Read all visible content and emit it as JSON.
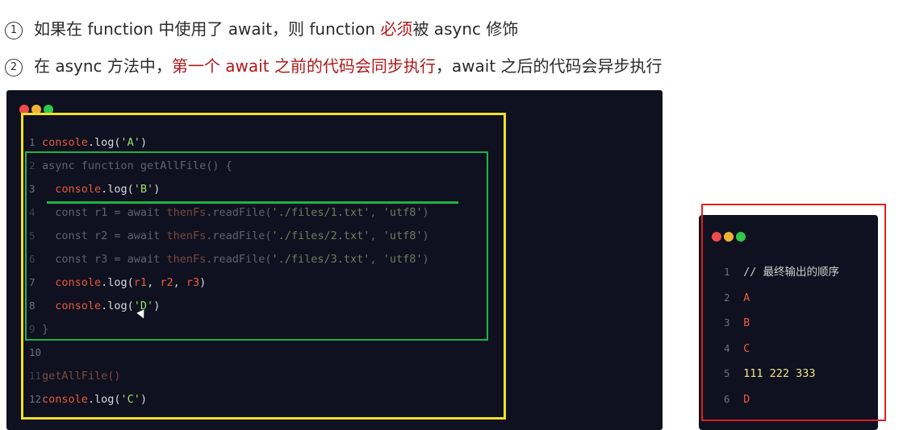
{
  "bullets": [
    {
      "marker": "1",
      "pre": "如果在 function 中使用了 await，则 function ",
      "highlight": "必须",
      "post": "被 async 修饰"
    },
    {
      "marker": "2",
      "pre": "在 async 方法中，",
      "highlight": "第一个 await 之前的代码会同步执行",
      "post": "，await 之后的代码会异步执行"
    }
  ],
  "colors": {
    "highlight_text": "#b01818",
    "editor_bg": "#0f1120",
    "yellow_box": "#f2e02a",
    "green_box": "#1fb344",
    "red_box": "#e01f1f"
  },
  "code": {
    "l1": {
      "n": "1",
      "a": "console",
      "b": ".log(",
      "c": "'A'",
      "d": ")"
    },
    "l2": {
      "n": "2",
      "a": "async function getAllFile() {"
    },
    "l3": {
      "n": "3",
      "a": "  console",
      "b": ".log(",
      "c": "'B'",
      "d": ")"
    },
    "l4": {
      "n": "4",
      "a": "  const r1 = await ",
      "b": "thenFs",
      "c": ".readFile(",
      "d": "'./files/1.txt'",
      "e": ", ",
      "f": "'utf8'",
      "g": ")"
    },
    "l5": {
      "n": "5",
      "a": "  const r2 = await ",
      "b": "thenFs",
      "c": ".readFile(",
      "d": "'./files/2.txt'",
      "e": ", ",
      "f": "'utf8'",
      "g": ")"
    },
    "l6": {
      "n": "6",
      "a": "  const r3 = await ",
      "b": "thenFs",
      "c": ".readFile(",
      "d": "'./files/3.txt'",
      "e": ", ",
      "f": "'utf8'",
      "g": ")"
    },
    "l7": {
      "n": "7",
      "a": "  console",
      "b": ".log(",
      "c": "r1",
      "d": ", ",
      "e": "r2",
      "f": ", ",
      "g": "r3",
      "h": ")"
    },
    "l8": {
      "n": "8",
      "a": "  console",
      "b": ".log(",
      "c": "'D'",
      "d": ")"
    },
    "l9": {
      "n": "9",
      "a": "}"
    },
    "l10": {
      "n": "10"
    },
    "l11": {
      "n": "11",
      "a": "getAllFile()"
    },
    "l12": {
      "n": "12",
      "a": "console",
      "b": ".log(",
      "c": "'C'",
      "d": ")"
    }
  },
  "output": {
    "l1": {
      "n": "1",
      "a": "// 最终输出的顺序"
    },
    "l2": {
      "n": "2",
      "a": "A"
    },
    "l3": {
      "n": "3",
      "a": "B"
    },
    "l4": {
      "n": "4",
      "a": "C"
    },
    "l5": {
      "n": "5",
      "a": "111 222 333"
    },
    "l6": {
      "n": "6",
      "a": "D"
    }
  }
}
